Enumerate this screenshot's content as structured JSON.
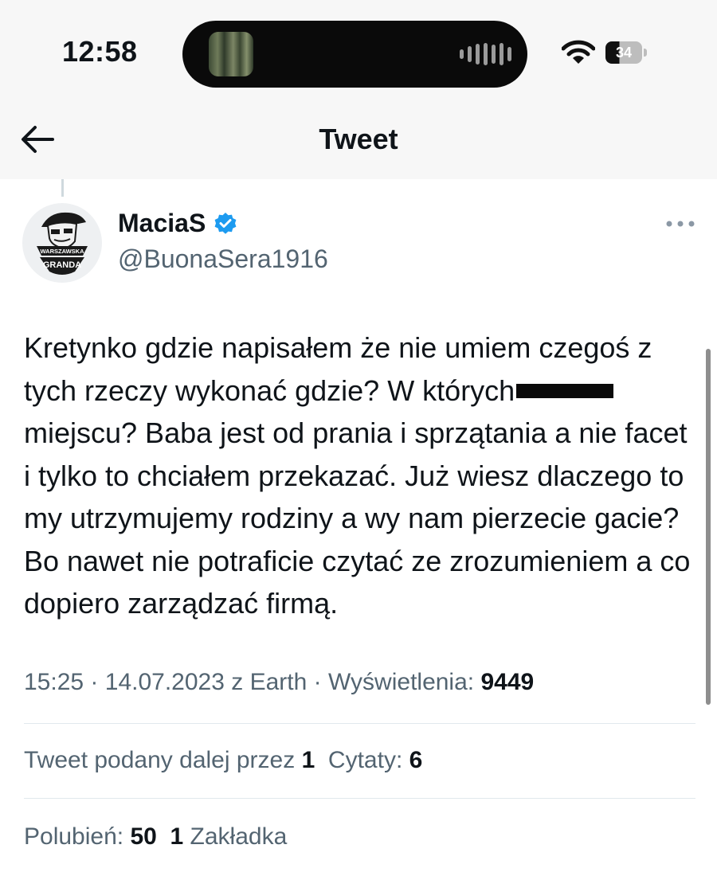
{
  "status_bar": {
    "time": "12:58",
    "battery": "34",
    "icons": [
      "wifi-icon",
      "battery-icon",
      "audio-wave-icon"
    ]
  },
  "header": {
    "title": "Tweet",
    "back_icon": "arrow-left-icon"
  },
  "tweet": {
    "author": {
      "display_name": "MaciaS",
      "handle": "@BuonaSera1916",
      "verified_icon": "verified-badge-icon",
      "avatar_text_top": "WARSZAWSKA",
      "avatar_text_bottom": "GRANDA"
    },
    "more_icon": "more-dots-icon",
    "text": {
      "part1": "Kretynko gdzie napisałem że nie umiem czegoś z tych rzeczy wykonać gdzie? W których",
      "part2": "miejscu? Baba jest od prania i sprzątania a nie facet i tylko to chciałem przekazać. Już wiesz dlaczego to my utrzymujemy rodziny a wy nam pierzecie gacie? Bo nawet nie potraficie czytać ze zrozumieniem a co dopiero zarządzać firmą."
    },
    "meta": {
      "time": "15:25",
      "date": "14.07.2023",
      "source": "z Earth",
      "views_label": "Wyświetlenia:",
      "views": "9449",
      "sep": "·"
    },
    "stats": {
      "retweets_label": "Tweet podany dalej przez",
      "retweets": "1",
      "quotes_label": "Cytaty:",
      "quotes": "6",
      "likes_label": "Polubień:",
      "likes": "50",
      "bookmarks": "1",
      "bookmarks_label": "Zakładka"
    }
  },
  "colors": {
    "text": "#0f1419",
    "secondary": "#536471",
    "verified": "#1d9bf0",
    "header_bg": "#f7f7f7",
    "divider": "#e1e8ed"
  }
}
